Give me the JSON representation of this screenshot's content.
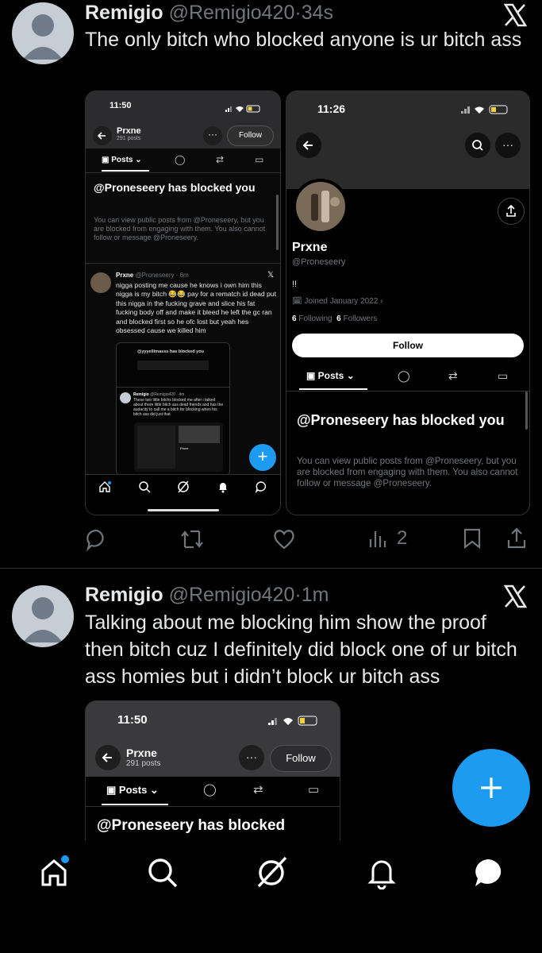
{
  "tweets": [
    {
      "display_name": "Remigio",
      "handle": "@Remigio420",
      "sep": "·",
      "time": "34s",
      "text": "The only bitch who blocked anyone is ur bitch ass",
      "views": "2"
    },
    {
      "display_name": "Remigio",
      "handle": "@Remigio420",
      "sep": "·",
      "time": "1m",
      "text": "Talking about me blocking him show the proof then bitch cuz I definitely did block one of ur bitch ass homies but i didn’t block ur bitch ass"
    }
  ],
  "shot_left": {
    "time": "11:50",
    "profile_name": "Prxne",
    "posts_count": "291 posts",
    "follow": "Follow",
    "tab_posts": "Posts",
    "blocked_title": "@Proneseery has blocked you",
    "blocked_desc": "You can view public posts from @Proneseery, but you are blocked from engaging with them. You also cannot follow or message @Proneseery.",
    "embed_name": "Prxne",
    "embed_handle": "@Proneseery · 6m",
    "embed_text": "nigga posting me cause he knows i own him this nigga is my bitch 😂😂 pay for a rematch id dead put this nigga in the fucking grave and slice his fat fucking body off and make it bleed he left the gc ran and blocked first so he ofc lost but yeah hes obsessed cause we killed him",
    "inner_blocked": "@yyyellimasss has blocked you",
    "inner_name": "Remigio",
    "inner_handle": "@Remigio420 · 4m",
    "inner_text": "These two little bitchs blocked me after i talked about there little bitch ass dead friends and has the audacity to call me a bitch for blocking when his bitch ass did just that",
    "inner_shot_name": "Prxne"
  },
  "shot_right": {
    "time": "11:26",
    "profile_name": "Prxne",
    "handle": "@Proneseery",
    "bio": "!!",
    "joined": "Joined January 2022",
    "following_count": "6",
    "following_label": "Following",
    "followers_count": "6",
    "followers_label": "Followers",
    "follow": "Follow",
    "tab_posts": "Posts",
    "blocked_title": "@Proneseery has blocked you",
    "blocked_desc": "You can view public posts from @Proneseery, but you are blocked from engaging with them. You also cannot follow or message @Proneseery."
  },
  "shot_bottom": {
    "time": "11:50",
    "profile_name": "Prxne",
    "posts_count": "291 posts",
    "follow": "Follow",
    "tab_posts": "Posts",
    "blocked_title": "@Proneseery has blocked"
  },
  "colors": {
    "accent": "#1d9bf0",
    "muted": "#71767b",
    "text": "#e7e9ea"
  }
}
